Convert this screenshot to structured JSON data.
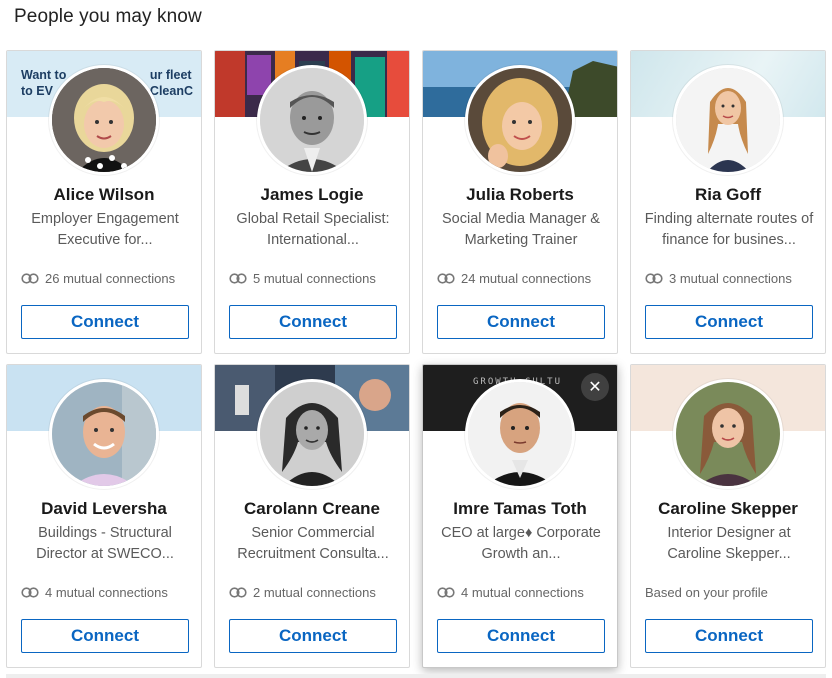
{
  "page": {
    "heading": "People you may know"
  },
  "colors": {
    "accent": "#0a66c2"
  },
  "cards": [
    {
      "name": "Alice Wilson",
      "headline": "Employer Engagement Executive for...",
      "mutual": "26 mutual connections",
      "connect_label": "Connect",
      "banner_line1_left": "Want to",
      "banner_line2_left": "to EV",
      "banner_line1_right": "ur fleet",
      "banner_line2_right": "CleanC"
    },
    {
      "name": "James Logie",
      "headline": "Global Retail Specialist: International...",
      "mutual": "5 mutual connections",
      "connect_label": "Connect"
    },
    {
      "name": "Julia Roberts",
      "headline": "Social Media Manager & Marketing Trainer",
      "mutual": "24 mutual connections",
      "connect_label": "Connect"
    },
    {
      "name": "Ria Goff",
      "headline": "Finding alternate routes of finance for busines...",
      "mutual": "3 mutual connections",
      "connect_label": "Connect"
    },
    {
      "name": "David Leversha",
      "headline": "Buildings - Structural Director at SWECO...",
      "mutual": "4 mutual connections",
      "connect_label": "Connect"
    },
    {
      "name": "Carolann Creane",
      "headline": "Senior Commercial Recruitment Consulta...",
      "mutual": "2 mutual connections",
      "connect_label": "Connect"
    },
    {
      "name": "Imre Tamas Toth",
      "headline": "CEO at large♦ Corporate Growth an...",
      "mutual": "4 mutual connections",
      "connect_label": "Connect",
      "dismiss_label": "✕",
      "banner_text": "GROWTH CULTU"
    },
    {
      "name": "Caroline Skepper",
      "headline": "Interior Designer at Caroline Skepper...",
      "mutual": "Based on your profile",
      "connect_label": "Connect"
    }
  ]
}
